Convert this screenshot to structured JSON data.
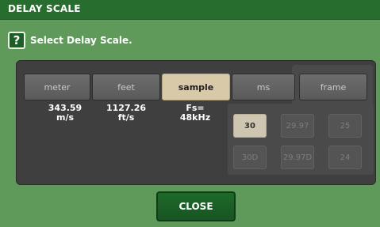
{
  "window": {
    "title": "DELAY SCALE"
  },
  "header": {
    "help_icon": "question-mark-icon",
    "prompt": "Select Delay Scale."
  },
  "units": [
    {
      "label": "meter",
      "value": "343.59\nm/s"
    },
    {
      "label": "feet",
      "value": "1127.26\nft/s"
    },
    {
      "label": "sample",
      "value": "Fs=\n48kHz",
      "selected": true
    },
    {
      "label": "ms",
      "value": ""
    },
    {
      "label": "frame",
      "value": ""
    }
  ],
  "frame_rates": [
    {
      "label": "30",
      "enabled": true
    },
    {
      "label": "29.97",
      "enabled": false
    },
    {
      "label": "25",
      "enabled": false
    },
    {
      "label": "30D",
      "enabled": false
    },
    {
      "label": "29.97D",
      "enabled": false
    },
    {
      "label": "24",
      "enabled": false
    }
  ],
  "footer": {
    "close_label": "CLOSE"
  },
  "colors": {
    "background": "#5f9a5a",
    "titlebar": "#276e2e",
    "selected_button": "#d8c9a8",
    "close_button": "#1e6a2a"
  }
}
